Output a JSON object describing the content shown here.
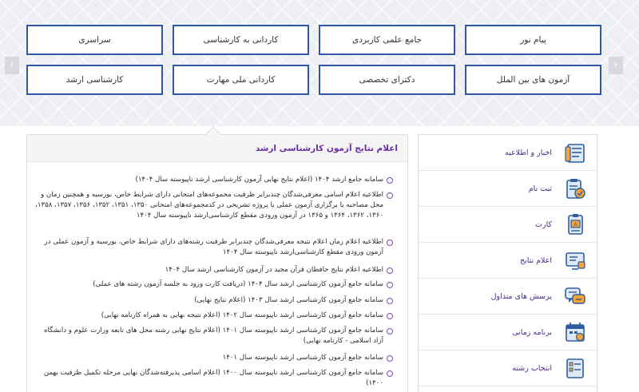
{
  "categories": [
    {
      "id": "payam-noor",
      "label": "پیام نور"
    },
    {
      "id": "jame-elmi",
      "label": "جامع علمی کاربردی"
    },
    {
      "id": "kardani-karshenasi",
      "label": "کاردانی به کارشناسی"
    },
    {
      "id": "sarasari",
      "label": "سراسری"
    },
    {
      "id": "beinolmelal",
      "label": "آزمون های بین الملل"
    },
    {
      "id": "doctora",
      "label": "دکترای تخصصی"
    },
    {
      "id": "kardani-melli",
      "label": "کاردانی ملی مهارت"
    },
    {
      "id": "karshenasi-arshad",
      "label": "کارشناسی ارشد"
    }
  ],
  "content": {
    "title": "اعلام نتایج آزمون کارشناسی ارشد",
    "items": [
      {
        "text": "سامانه جامع ارشد ۱۴۰۴ (اعلام نتایج نهایی آزمون کارشناسی ارشد ناپیوسته سال ۱۴۰۴)"
      },
      {
        "text": "اطلاعیه اعلام اسامی معرفی‌شدگان چندبرابر ظرفیت مجموعه‌های امتحانی دارای شرایط خاص، بورسیه و همچنین زمان و محل مصاحبه یا برگزاری آزمون عملی یا پروژه تشریحی در کدمجموعه‌های امتحانی ۱۳۵۰، ۱۳۵۱، ۱۳۵۲، ۱۳۵۶، ۱۳۵۷، ۱۳۵۸، ۱۳۶۰، ۱۳۶۲، ۱۳۶۴ و ۱۳۶۵ در آزمون ورودی مقطع کارشناسی‌ارشد ناپیوسته سال ۱۴۰۴"
      },
      {
        "text": "اطلاعیه اعلام زمان اعلام نتیجه معرفی‌شدگان چندبرابر ظرفیت رشته‌های دارای شرایط خاص، بورسیه و آزمون عملی در آزمون ورودی مقطع کارشناسی‌ارشد ناپیوسته سال ۱۴۰۴"
      },
      {
        "text": "اطلاعیه اعلام نتایج حافظان قرآن مجید در آزمون کارشناسی ارشد سال ۱۴۰۴"
      },
      {
        "text": "سامانه جامع آزمون کارشناسی ارشد سال ۱۴۰۴ (دریافت کارت ورود به جلسه آزمون رشته های عملی)"
      },
      {
        "text": "سامانه جامع آزمون کارشناسی ارشد سال ۱۴۰۳ (اعلام نتایج نهایی)"
      },
      {
        "text": "سامانه جامع آزمون کارشناسی ارشد ناپیوسته سال ۱۴۰۲ (اعلام نتیجه نهایی به همراه کارنامه نهایی)"
      },
      {
        "text": "سامانه جامع آزمون کارشناسی ارشد ناپیوسته سال ۱۴۰۱ (اعلام نتایج نهایی رشته محل های تابعه وزارت علوم و دانشگاه آزاد اسلامی - کارنامه نهایی)"
      },
      {
        "text": "سامانه جامع آزمون کارشناسی ارشد ناپیوسته سال ۱۴۰۱"
      },
      {
        "text": "سامانه جامع آزمون کارشناسی ارشد ناپیوسته سال ۱۴۰۰ (اعلام اسامی پذیرفته‌شدگان نهایی مرحله تکمیل ظرفیت بهمن ۱۴۰۰)"
      }
    ]
  },
  "sidebar": {
    "items": [
      {
        "label": "اخبار و اطلاعیه",
        "icon": "news-document-icon"
      },
      {
        "label": "ثبت نام",
        "icon": "registration-clipboard-icon"
      },
      {
        "label": "کارت",
        "icon": "id-card-icon"
      },
      {
        "label": "اعلام نتایج",
        "icon": "results-screen-icon"
      },
      {
        "label": "پرسش های متداول",
        "icon": "faq-chat-icon"
      },
      {
        "label": "برنامه زمانی",
        "icon": "calendar-icon"
      },
      {
        "label": "انتخاب رشته",
        "icon": "selection-list-icon"
      }
    ]
  },
  "colors": {
    "button_border": "#2f57a8",
    "accent_purple": "#6a2ea3",
    "icon_blue": "#2f5d9e",
    "icon_orange": "#f2a33a"
  }
}
